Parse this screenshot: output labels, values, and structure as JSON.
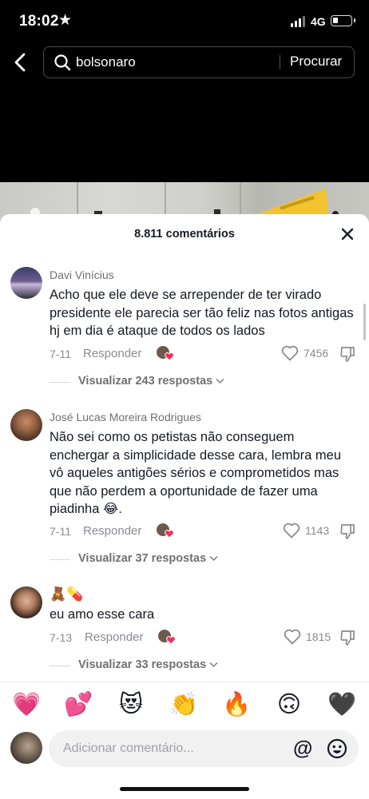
{
  "status_bar": {
    "time": "18:02",
    "network": "4G",
    "battery_level": 0.3
  },
  "search": {
    "query": "bolsonaro",
    "submit_label": "Procurar"
  },
  "comments_panel": {
    "title": "8.811 comentários",
    "comments": [
      {
        "username": "Davi Vinícius",
        "text": "Acho que ele deve se arrepender de ter virado presidente ele parecia ser tão feliz nas fotos antigas hj em dia é ataque de todos os lados",
        "date": "7-11",
        "reply_label": "Responder",
        "likes": "7456",
        "replies_label": "Visualizar 243 respostas"
      },
      {
        "username": "José Lucas Moreira Rodrigues",
        "text": "Não sei como os petistas não conseguem enchergar a simplicidade desse cara, lembra meu vô aqueles antigões sérios e comprometidos mas que não perdem a oportunidade de fazer uma piadinha 😂.",
        "date": "7-11",
        "reply_label": "Responder",
        "likes": "1143",
        "replies_label": "Visualizar 37 respostas"
      },
      {
        "username": "🧸💊",
        "text": "eu amo esse cara",
        "date": "7-13",
        "reply_label": "Responder",
        "likes": "1815",
        "replies_label": "Visualizar 33 respostas"
      }
    ]
  },
  "emoji_bar": [
    "💗",
    "💕",
    "😻",
    "👏",
    "🔥",
    "🙃",
    "🖤"
  ],
  "composer": {
    "placeholder": "Adicionar comentário...",
    "mention_symbol": "@"
  }
}
